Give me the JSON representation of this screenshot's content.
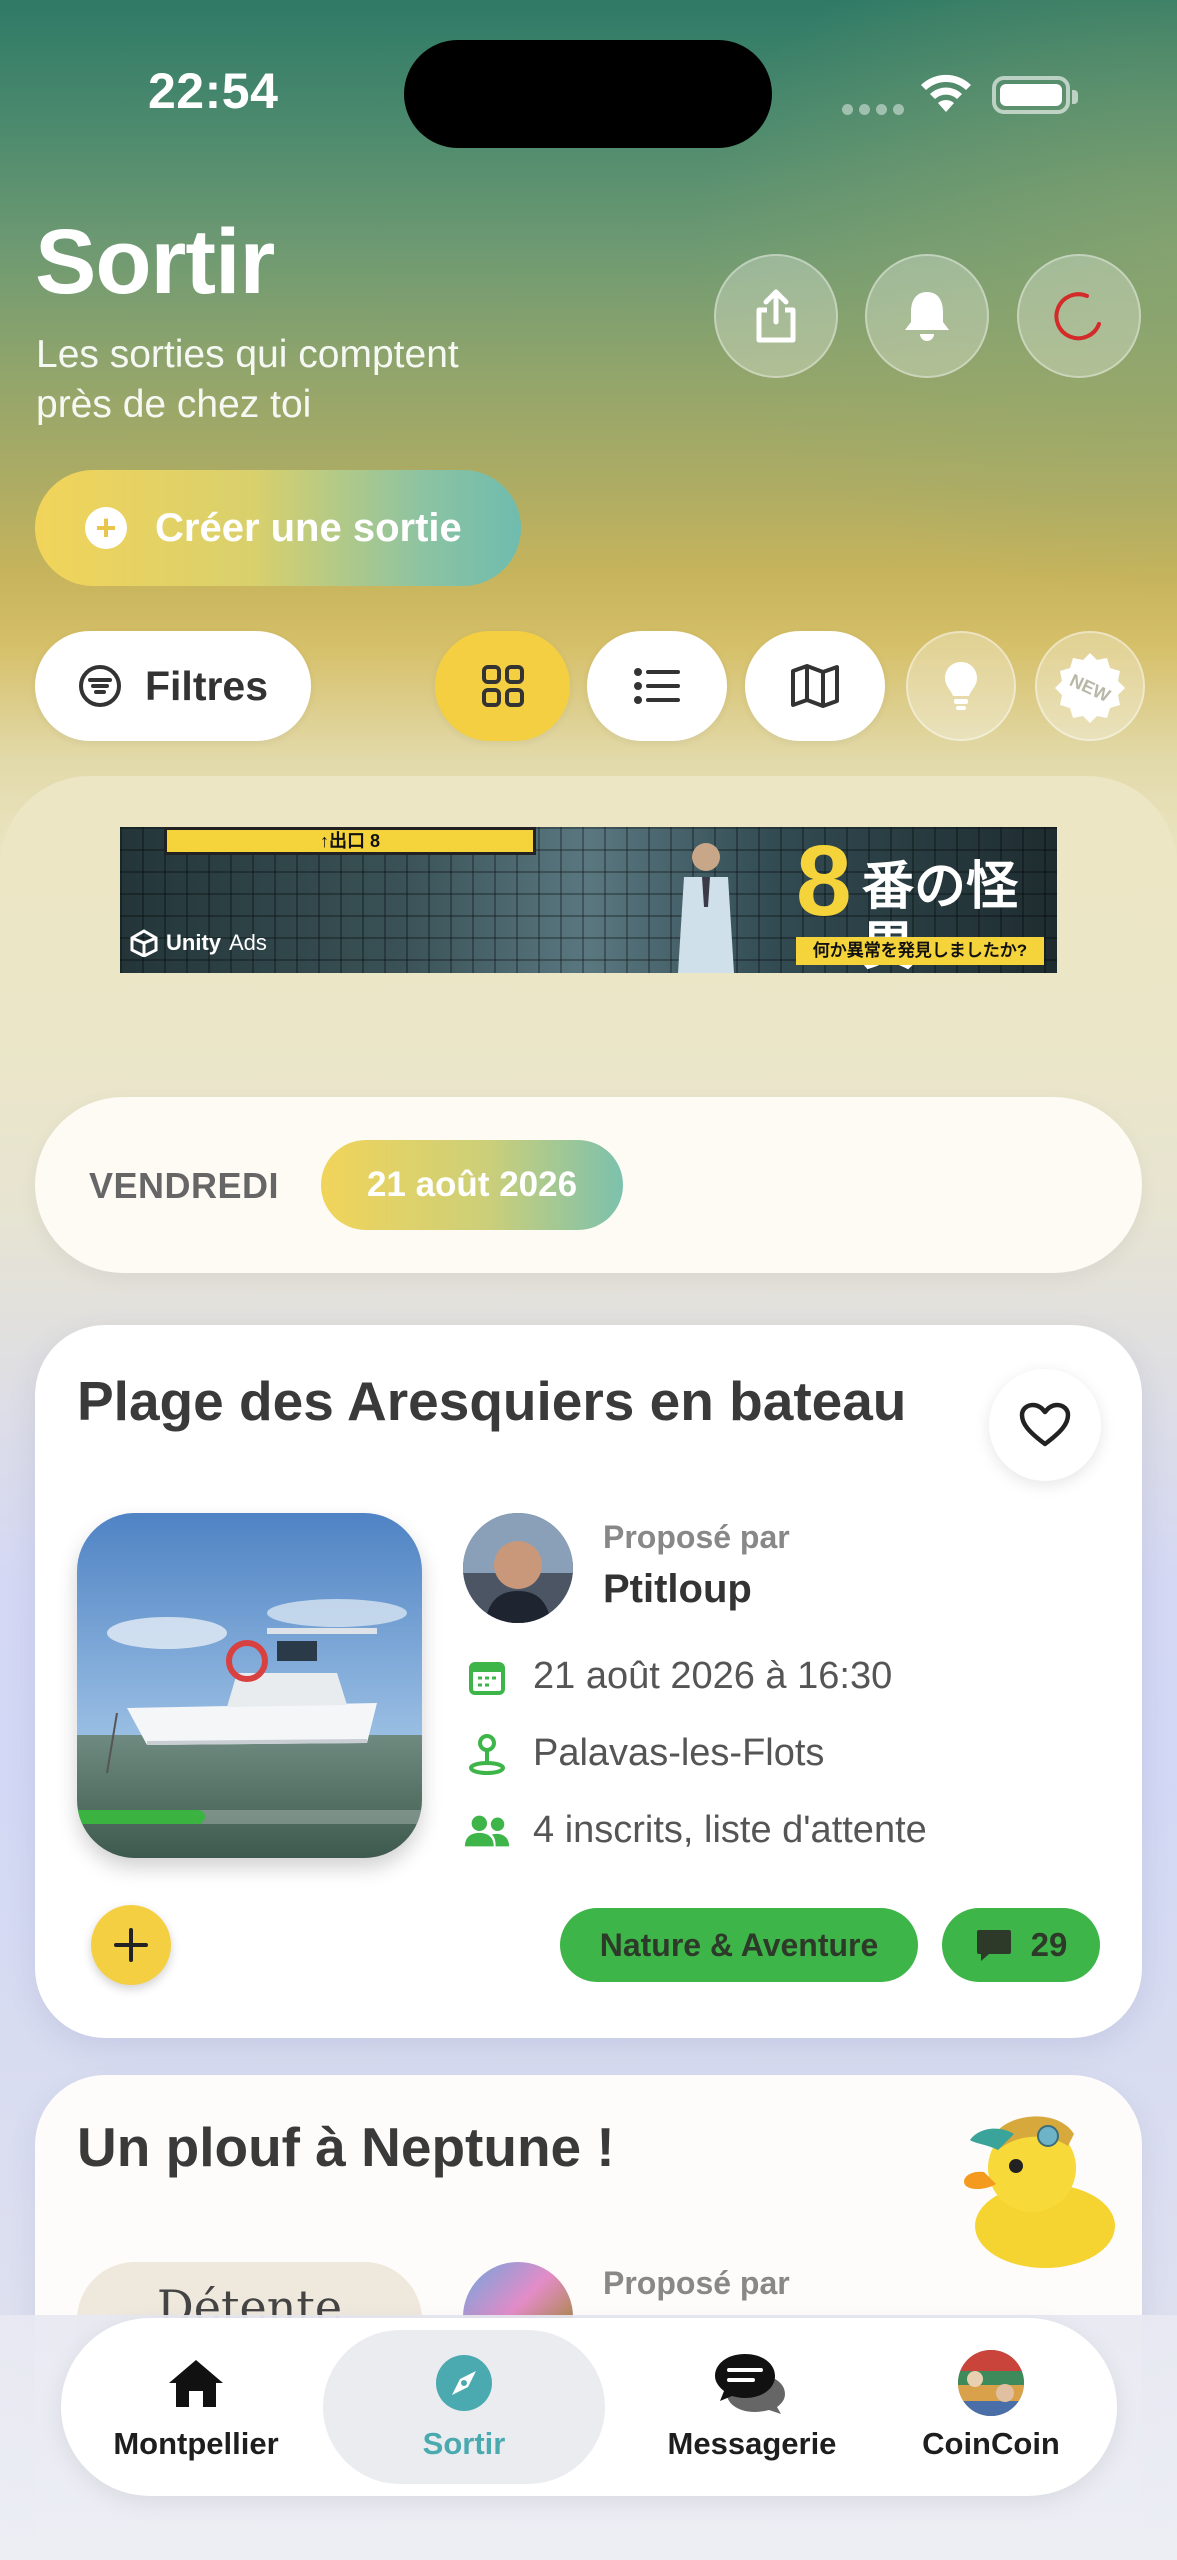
{
  "status_bar": {
    "time": "22:54"
  },
  "header": {
    "title": "Sortir",
    "subtitle_line1": "Les sorties qui comptent",
    "subtitle_line2": "près de chez toi",
    "create_button": "Créer une sortie"
  },
  "toolbar": {
    "filters_label": "Filtres",
    "active_view": "grid"
  },
  "ad": {
    "provider": "Unity",
    "provider_suffix": "Ads",
    "sign_text": "↑出口 8",
    "headline_number": "8",
    "headline_text": "番の怪異",
    "subline": "何か異常を発見しましたか?"
  },
  "day": {
    "weekday": "VENDREDI",
    "date": "21 août 2026"
  },
  "event1": {
    "title": "Plage des Aresquiers en bateau",
    "proposed_by_label": "Proposé par",
    "proposer": "Ptitloup",
    "datetime": "21 août 2026 à 16:30",
    "location": "Palavas-les-Flots",
    "attendees": "4 inscrits, liste d'attente",
    "category": "Nature & Aventure",
    "comments": "29",
    "fill_progress": 0.37
  },
  "event2": {
    "title": "Un plouf à Neptune !",
    "image_text": "Détente",
    "proposed_by_label": "Proposé par"
  },
  "nav": {
    "items": [
      {
        "label": "Montpellier",
        "icon": "home-icon"
      },
      {
        "label": "Sortir",
        "icon": "compass-icon",
        "active": true
      },
      {
        "label": "Messagerie",
        "icon": "chat-icon"
      },
      {
        "label": "CoinCoin",
        "icon": "avatar-icon"
      }
    ]
  },
  "colors": {
    "accent_yellow": "#f5cf42",
    "category_green": "#3eb549",
    "active_nav_teal": "#4aaab0"
  }
}
